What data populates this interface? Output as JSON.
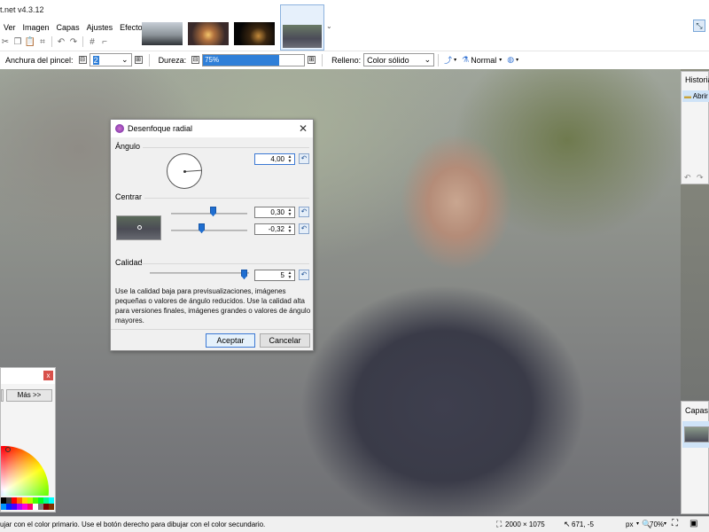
{
  "app": {
    "title": "t.net v4.3.12"
  },
  "menu": {
    "items": [
      "Ver",
      "Imagen",
      "Capas",
      "Ajustes",
      "Efectos"
    ]
  },
  "toolbar": {
    "icons": [
      "cut-icon",
      "copy-icon",
      "paste-icon",
      "crop-icon",
      "undo-icon",
      "redo-icon",
      "grid-icon",
      "ruler-icon"
    ],
    "dropdown_glyph": "⌄",
    "top_right_icon_glyph": "⤡"
  },
  "options": {
    "brush_label": "Anchura del pincel:",
    "brush_value": "2",
    "hardness_label": "Dureza:",
    "hardness_value": "75%",
    "hardness_fraction": 0.75,
    "fill_label": "Relleno:",
    "fill_value": "Color sólido",
    "blend_value": "Normal",
    "minus_glyph": "⊟",
    "plus_glyph": "⊞"
  },
  "dialog": {
    "title": "Desenfoque radial",
    "close_glyph": "✕",
    "angle_label": "Ángulo",
    "angle_value": "4,00",
    "center_label": "Centrar",
    "center_x": "0,30",
    "center_y": "-0,32",
    "quality_label": "Calidad",
    "quality_value": "5",
    "help_text": "Use la calidad baja para previsualizaciones, imágenes pequeñas o valores de ángulo reducidos. Use la calidad alta para versiones finales, imágenes grandes o valores de ángulo mayores.",
    "accept_label": "Aceptar",
    "cancel_label": "Cancelar",
    "reset_glyph": "↶"
  },
  "colors_panel": {
    "more_label": "Más >>",
    "close_glyph": "x",
    "palette": [
      "#000000",
      "#404040",
      "#ff0000",
      "#ff6a00",
      "#ffd800",
      "#b6ff00",
      "#4cff00",
      "#00ff21",
      "#00ff90",
      "#00ffff",
      "#0094ff",
      "#0026ff",
      "#4800ff",
      "#b200ff",
      "#ff00dc",
      "#ff006e",
      "#ffffff",
      "#808080",
      "#7f0000",
      "#7f3300"
    ]
  },
  "history_panel": {
    "title": "Historia",
    "item": "Abrir",
    "undo_glyph": "↶",
    "redo_glyph": "↷"
  },
  "layers_panel": {
    "title": "Capas"
  },
  "status": {
    "hint": "ujar con el color primario. Use el botón derecho para dibujar con el color secundario.",
    "size": "2000 × 1075",
    "coords": "671, -5",
    "units": "px",
    "zoom": "70%",
    "units_arrow": "▾",
    "zoom_arrow": "▾",
    "size_icon_glyph": "⛶",
    "coord_icon_glyph": "↖",
    "zoom_icon_glyph": "🔍",
    "fit_icon_glyph": "⛶",
    "actual_icon_glyph": "▣"
  }
}
